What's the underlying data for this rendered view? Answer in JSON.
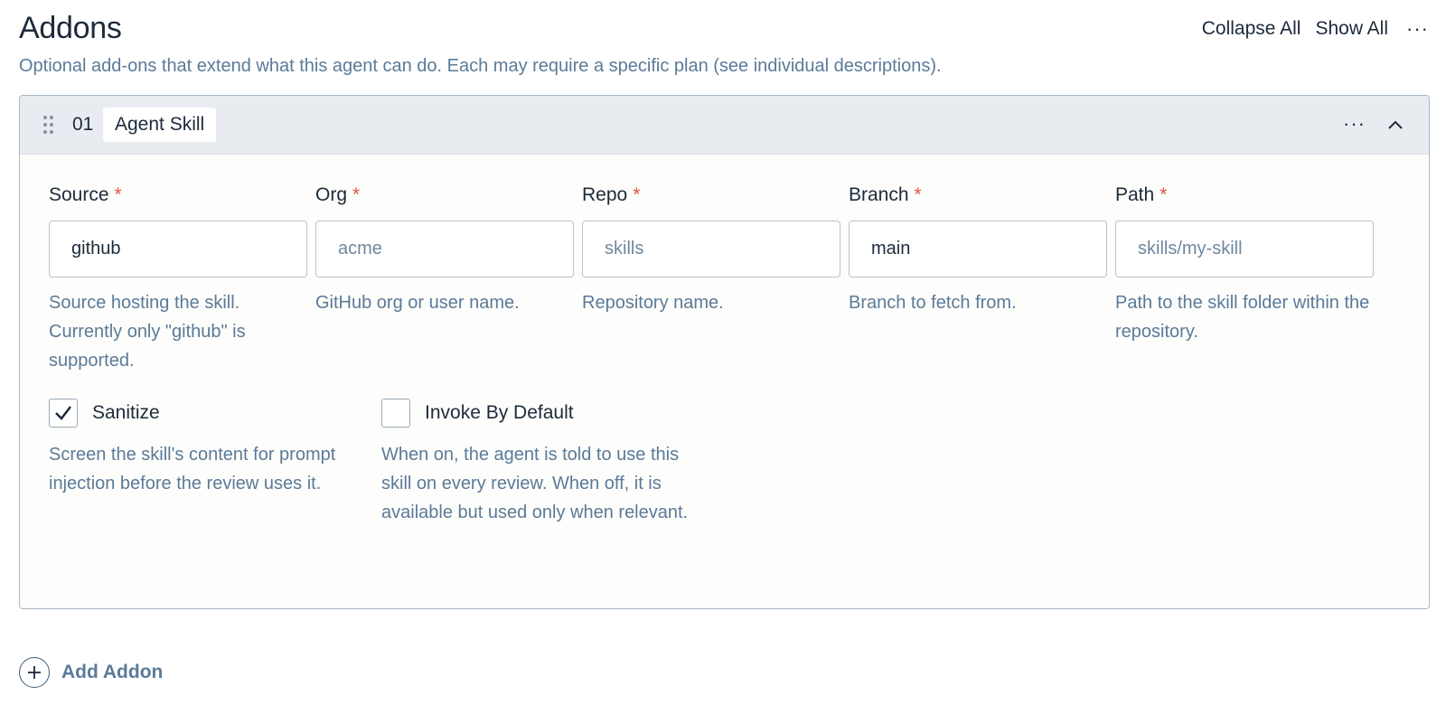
{
  "header": {
    "title": "Addons",
    "subtitle": "Optional add-ons that extend what this agent can do. Each may require a specific plan (see individual descriptions).",
    "collapse_all": "Collapse All",
    "show_all": "Show All",
    "more_icon": "ellipsis-icon"
  },
  "addon": {
    "index": "01",
    "name": "Agent Skill",
    "fields": [
      {
        "label": "Source",
        "required_mark": "*",
        "value": "github",
        "placeholder": "",
        "help": "Source hosting the skill. Currently only \"github\" is supported."
      },
      {
        "label": "Org",
        "required_mark": "*",
        "value": "",
        "placeholder": "acme",
        "help": "GitHub org or user name."
      },
      {
        "label": "Repo",
        "required_mark": "*",
        "value": "",
        "placeholder": "skills",
        "help": "Repository name."
      },
      {
        "label": "Branch",
        "required_mark": "*",
        "value": "main",
        "placeholder": "",
        "help": "Branch to fetch from."
      },
      {
        "label": "Path",
        "required_mark": "*",
        "value": "",
        "placeholder": "skills/my-skill",
        "help": "Path to the skill folder within the repository."
      }
    ],
    "checkboxes": [
      {
        "label": "Sanitize",
        "checked": true,
        "help": "Screen the skill's content for prompt injection before the review uses it."
      },
      {
        "label": "Invoke By Default",
        "checked": false,
        "help": "When on, the agent is told to use this skill on every review. When off, it is available but used only when relevant."
      }
    ]
  },
  "footer": {
    "add_addon": "Add Addon"
  },
  "colors": {
    "accent_text": "#5b7a98",
    "required": "#e4553a",
    "card_header_bg": "#e8ecf1"
  }
}
